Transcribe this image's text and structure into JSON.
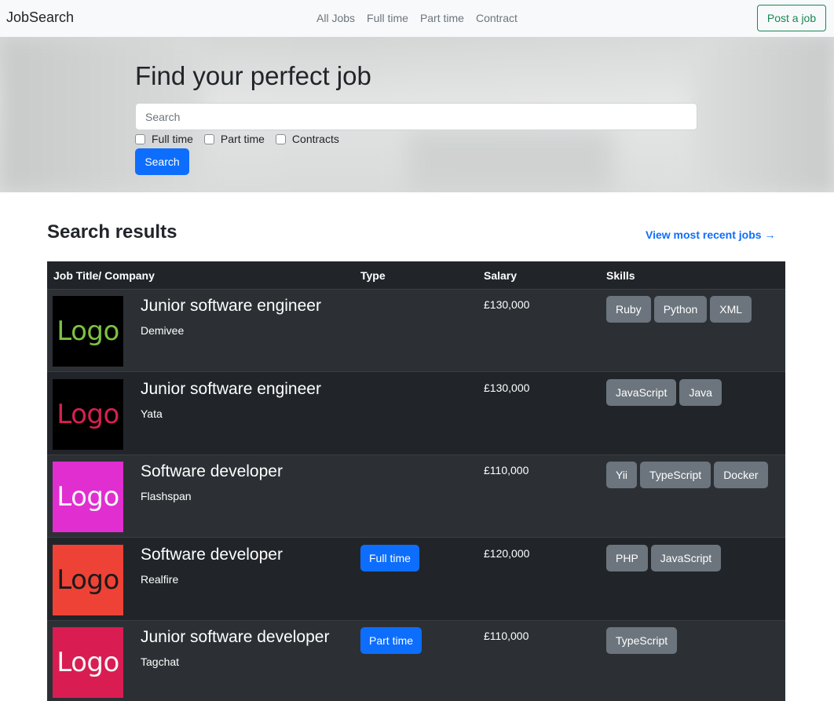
{
  "navbar": {
    "brand": "JobSearch",
    "links": [
      "All Jobs",
      "Full time",
      "Part time",
      "Contract"
    ],
    "post_button": "Post a job"
  },
  "hero": {
    "title": "Find your perfect job",
    "search_placeholder": "Search",
    "filters": [
      "Full time",
      "Part time",
      "Contracts"
    ],
    "search_button": "Search"
  },
  "results": {
    "title": "Search results",
    "recent_link": "View most recent jobs →",
    "columns": [
      "Job Title/ Company",
      "Type",
      "Salary",
      "Skills"
    ],
    "jobs": [
      {
        "title": "Junior software engineer",
        "company": "Demivee",
        "type": "",
        "salary": "£130,000",
        "skills": [
          "Ruby",
          "Python",
          "XML"
        ],
        "logo_text": "Logo",
        "logo_bg": "#000000",
        "logo_fg": "#7dc243"
      },
      {
        "title": "Junior software engineer",
        "company": "Yata",
        "type": "",
        "salary": "£130,000",
        "skills": [
          "JavaScript",
          "Java"
        ],
        "logo_text": "Logo",
        "logo_bg": "#000000",
        "logo_fg": "#d8204f"
      },
      {
        "title": "Software developer",
        "company": "Flashspan",
        "type": "",
        "salary": "£110,000",
        "skills": [
          "Yii",
          "TypeScript",
          "Docker"
        ],
        "logo_text": "Logo",
        "logo_bg": "#e02ed0",
        "logo_fg": "#f5f5f5"
      },
      {
        "title": "Software developer",
        "company": "Realfire",
        "type": "Full time",
        "salary": "£120,000",
        "skills": [
          "PHP",
          "JavaScript"
        ],
        "logo_text": "Logo",
        "logo_bg": "#ee4236",
        "logo_fg": "#1a1a1a"
      },
      {
        "title": "Junior software developer",
        "company": "Tagchat",
        "type": "Part time",
        "salary": "£110,000",
        "skills": [
          "TypeScript"
        ],
        "logo_text": "Logo",
        "logo_bg": "#d91c52",
        "logo_fg": "#f5f5f5"
      }
    ]
  }
}
